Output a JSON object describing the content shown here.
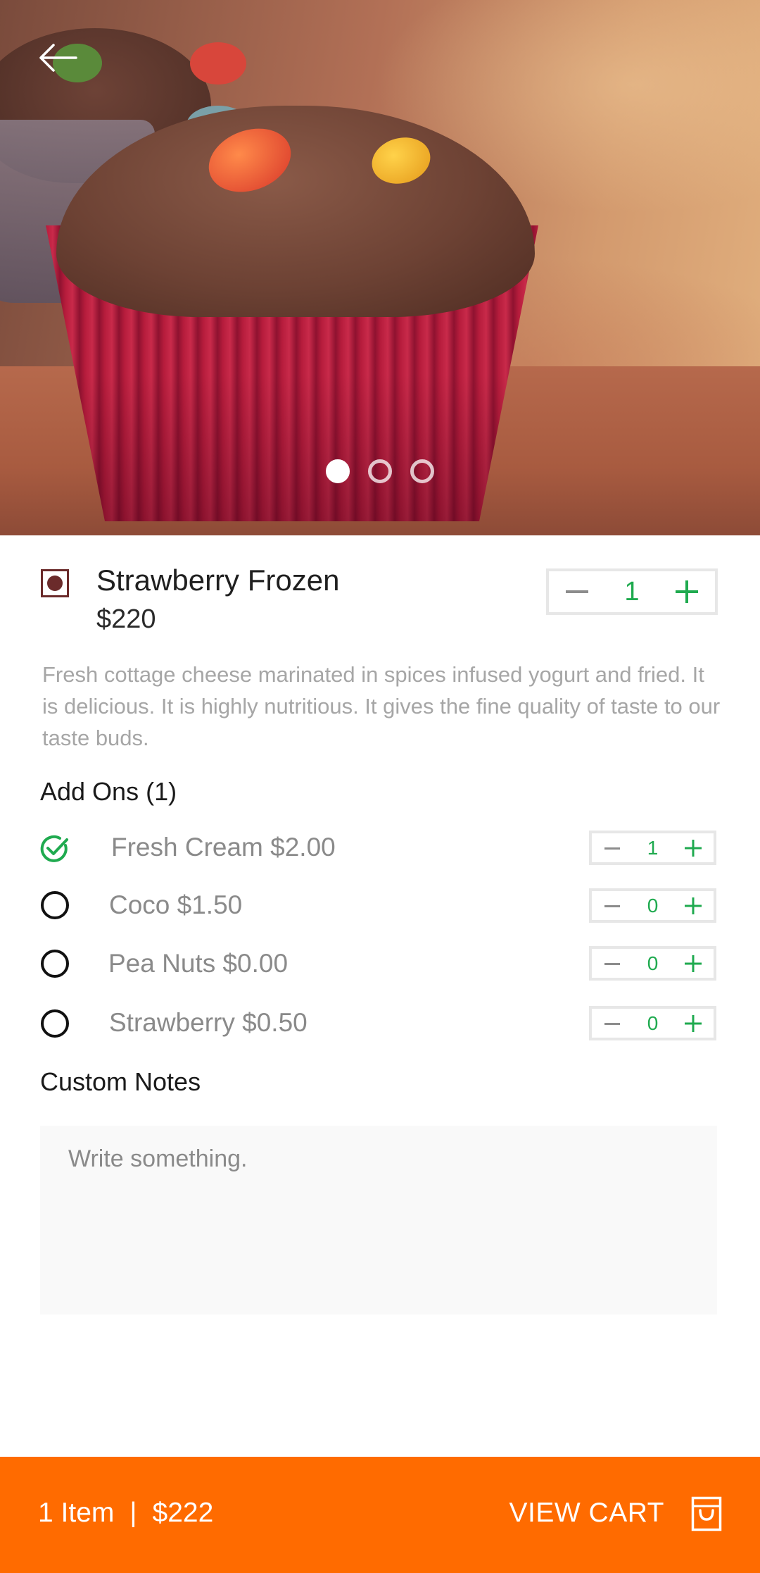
{
  "hero": {
    "image_alt": "Chocolate muffin with candy in a red cupcake liner",
    "slide_count": 3,
    "active_slide": 1
  },
  "product": {
    "name": "Strawberry Frozen",
    "price": "$220",
    "quantity": "1",
    "description": "Fresh cottage cheese marinated in spices infused yogurt and fried. It is delicious. It is highly nutritious. It gives the fine quality of taste to our taste buds.",
    "indicator_color": "#6b2b2b"
  },
  "addons": {
    "heading": "Add Ons (1)",
    "items": [
      {
        "label": "Fresh Cream $2.00",
        "quantity": "1",
        "selected": true
      },
      {
        "label": "Coco $1.50",
        "quantity": "0",
        "selected": false
      },
      {
        "label": "Pea Nuts $0.00",
        "quantity": "0",
        "selected": false
      },
      {
        "label": "Strawberry $0.50",
        "quantity": "0",
        "selected": false
      }
    ]
  },
  "notes": {
    "heading": "Custom Notes",
    "placeholder": "Write something."
  },
  "cart": {
    "items": "1 Item",
    "separator": "|",
    "total": "$222",
    "action": "VIEW CART"
  },
  "colors": {
    "accent_green": "#1faa4f",
    "cart_orange": "#ff6b00",
    "muted_text": "#a6a6a6"
  }
}
